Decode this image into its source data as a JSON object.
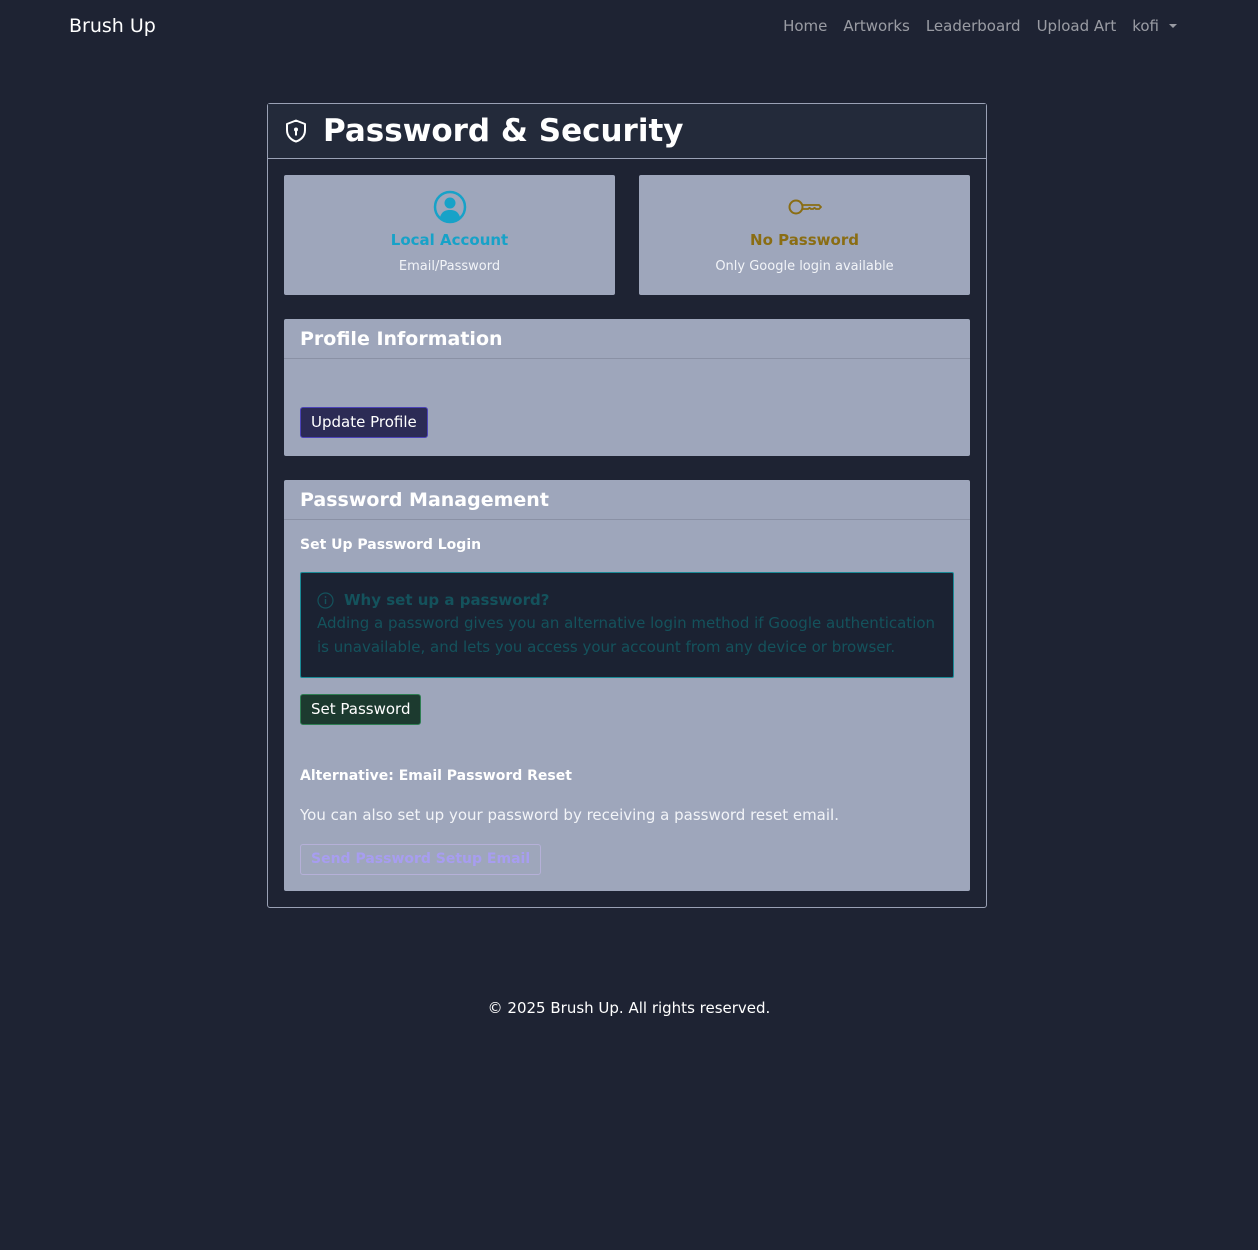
{
  "nav": {
    "brand": "Brush Up",
    "links": [
      "Home",
      "Artworks",
      "Leaderboard",
      "Upload Art"
    ],
    "user": "kofi"
  },
  "page": {
    "title": "Password & Security"
  },
  "status": {
    "account": {
      "title": "Local Account",
      "subtitle": "Email/Password",
      "color": "#17a2c8"
    },
    "password": {
      "title": "No Password",
      "subtitle": "Only Google login available",
      "color": "#8a6d13"
    }
  },
  "profile": {
    "heading": "Profile Information",
    "button": "Update Profile"
  },
  "password_mgmt": {
    "heading": "Password Management",
    "setup_heading": "Set Up Password Login",
    "info_title": "Why set up a password?",
    "info_text": "Adding a password gives you an alternative login method if Google authentication is unavailable, and lets you access your account from any device or browser.",
    "set_button": "Set Password",
    "alt_heading": "Alternative: Email Password Reset",
    "alt_text": "You can also set up your password by receiving a password reset email.",
    "email_button": "Send Password Setup Email"
  },
  "footer": {
    "text": "© 2025 Brush Up. All rights reserved."
  }
}
